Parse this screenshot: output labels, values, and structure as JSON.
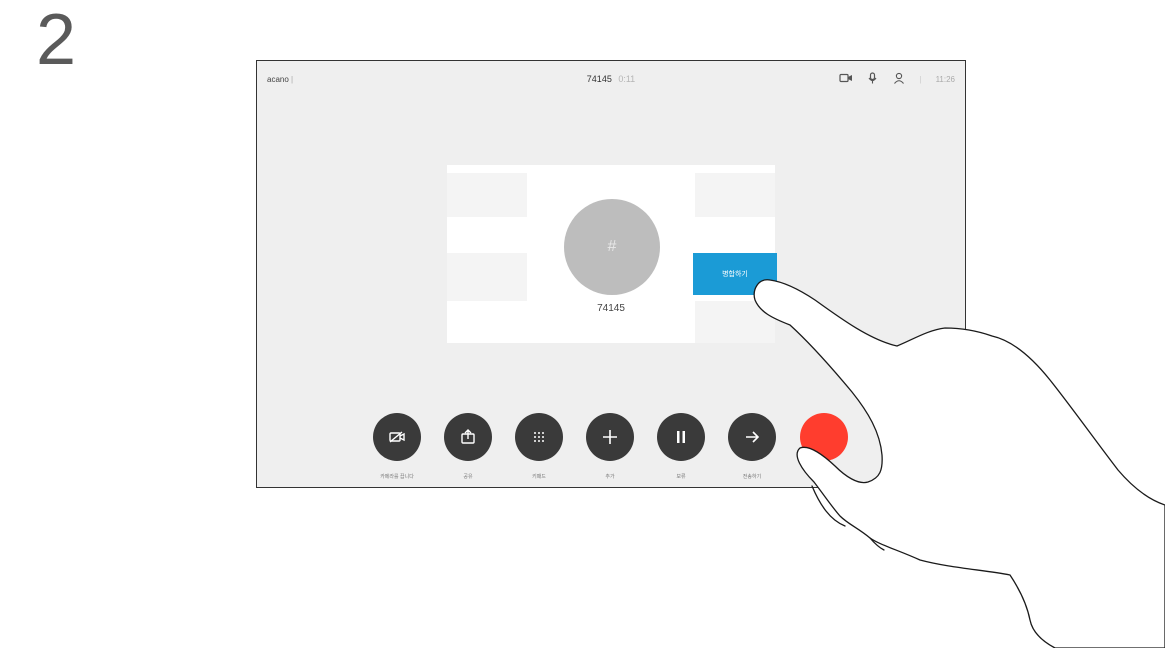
{
  "step": "2",
  "topbar": {
    "brand": "acano",
    "brand_suffix": "|",
    "call_number": "74145",
    "call_timer": "0:11",
    "time": "11:26",
    "separator": "|"
  },
  "participant": {
    "avatar_glyph": "#",
    "number": "74145"
  },
  "merge_button_label": "병합하기",
  "controls": [
    {
      "icon": "camera-off-icon",
      "label": "카메라를 끕니다"
    },
    {
      "icon": "share-icon",
      "label": "공유"
    },
    {
      "icon": "keypad-icon",
      "label": "키패드"
    },
    {
      "icon": "add-icon",
      "label": "추가"
    },
    {
      "icon": "pause-icon",
      "label": "보류"
    },
    {
      "icon": "transfer-icon",
      "label": "전송하기"
    },
    {
      "icon": "end-call-icon",
      "label": ""
    }
  ],
  "colors": {
    "screen_bg": "#efefef",
    "merge_blue": "#1b9bd6",
    "control_dark": "#3a3a3a",
    "end_red": "#ff3d2e"
  }
}
